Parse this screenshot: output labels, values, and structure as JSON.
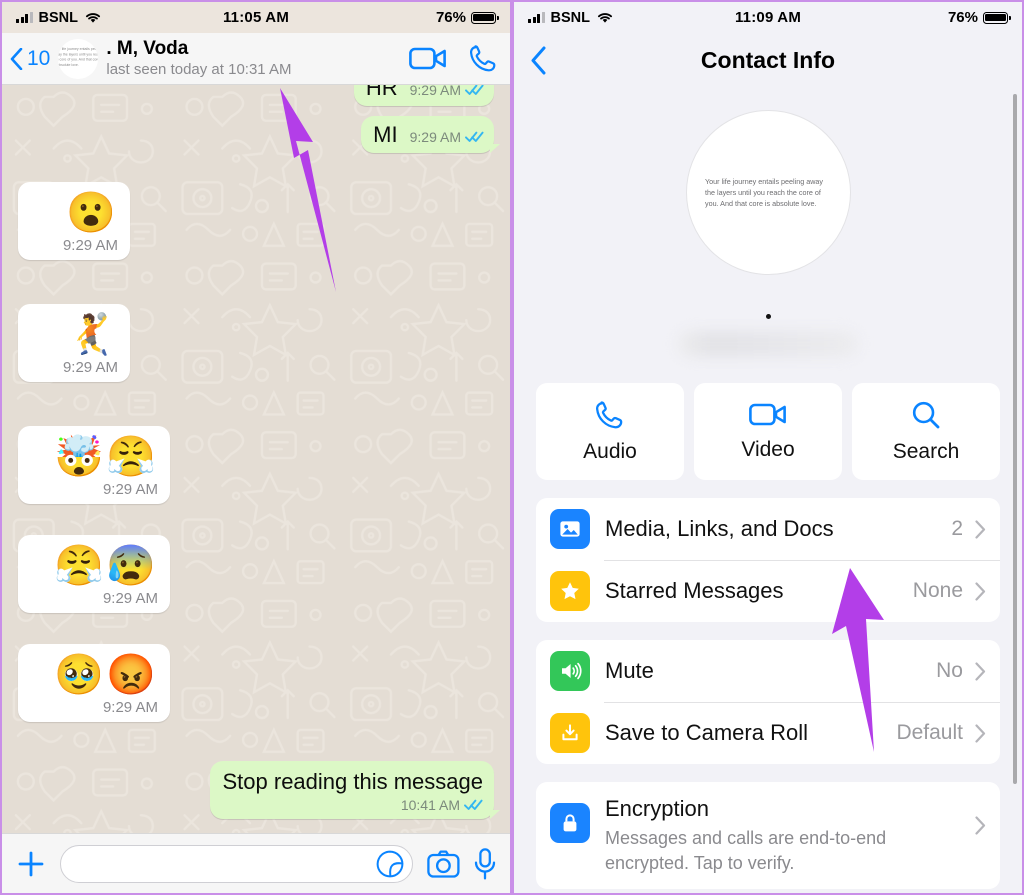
{
  "left_panel": {
    "status_bar": {
      "carrier": "BSNL",
      "time": "11:05 AM",
      "battery": "76%"
    },
    "header": {
      "back_count": "10",
      "avatar_quote": "Your life journey entails peeling away the layers until you reach the core of you. And that core is absolute love.",
      "contact_name": ". M, Voda",
      "last_seen": "last seen today at 10:31 AM",
      "video_icon": "video-camera-icon",
      "call_icon": "phone-icon"
    },
    "messages": [
      {
        "kind": "outgoing-text",
        "text": "HR",
        "time": "9:29 AM",
        "status": "read"
      },
      {
        "kind": "outgoing-text",
        "text": "MI",
        "time": "9:29 AM",
        "status": "read"
      },
      {
        "kind": "incoming-sticker",
        "emojis": "😮",
        "time": "9:29 AM"
      },
      {
        "kind": "incoming-sticker",
        "emojis": "🤾",
        "time": "9:29 AM"
      },
      {
        "kind": "incoming-sticker",
        "emojis": "🤯😤",
        "time": "9:29 AM"
      },
      {
        "kind": "incoming-sticker",
        "emojis": "😤😰",
        "time": "9:29 AM"
      },
      {
        "kind": "incoming-sticker",
        "emojis": "🥹😡",
        "time": "9:29 AM"
      },
      {
        "kind": "outgoing-text",
        "text": "Stop reading this message",
        "time": "10:41 AM",
        "status": "read"
      }
    ],
    "input_bar": {
      "plus_icon": "plus-icon",
      "message_placeholder": "",
      "sticker_icon": "sticker-icon",
      "camera_icon": "camera-icon",
      "mic_icon": "microphone-icon"
    }
  },
  "right_panel": {
    "status_bar": {
      "carrier": "BSNL",
      "time": "11:09 AM",
      "battery": "76%"
    },
    "nav": {
      "title": "Contact Info",
      "back_icon": "chevron-left-icon"
    },
    "profile": {
      "avatar_quote": "Your life journey entails peeling away the layers until you reach the core of you. And that core is absolute love.",
      "name": ""
    },
    "actions": [
      {
        "label": "Audio",
        "icon": "phone-icon"
      },
      {
        "label": "Video",
        "icon": "video-camera-icon"
      },
      {
        "label": "Search",
        "icon": "search-icon"
      }
    ],
    "groups": [
      {
        "rows": [
          {
            "label": "Media, Links, and Docs",
            "value": "2",
            "icon": "photo-icon",
            "icon_color": "#1A84FF"
          },
          {
            "label": "Starred Messages",
            "value": "None",
            "icon": "star-icon",
            "icon_color": "#FFC40C"
          }
        ]
      },
      {
        "rows": [
          {
            "label": "Mute",
            "value": "No",
            "icon": "speaker-icon",
            "icon_color": "#33C759"
          },
          {
            "label": "Save to Camera Roll",
            "value": "Default",
            "icon": "save-download-icon",
            "icon_color": "#FFC40C"
          }
        ]
      },
      {
        "rows": [
          {
            "label": "Encryption",
            "desc": "Messages and calls are end-to-end encrypted. Tap to verify.",
            "icon": "lock-icon",
            "icon_color": "#1A84FF"
          }
        ]
      }
    ]
  },
  "annotations": {
    "arrow_color": "#B33EE8",
    "arrows": [
      {
        "name": "arrow-pointing-to-chat-header"
      },
      {
        "name": "arrow-pointing-to-media-links-docs"
      }
    ]
  },
  "colors": {
    "accent_blue": "#0A84FF",
    "bubble_green": "#DCF8C6",
    "chat_bg": "#E4DDD4",
    "panel_bg": "#F2F2F7",
    "border_purple": "#C98FE8"
  }
}
